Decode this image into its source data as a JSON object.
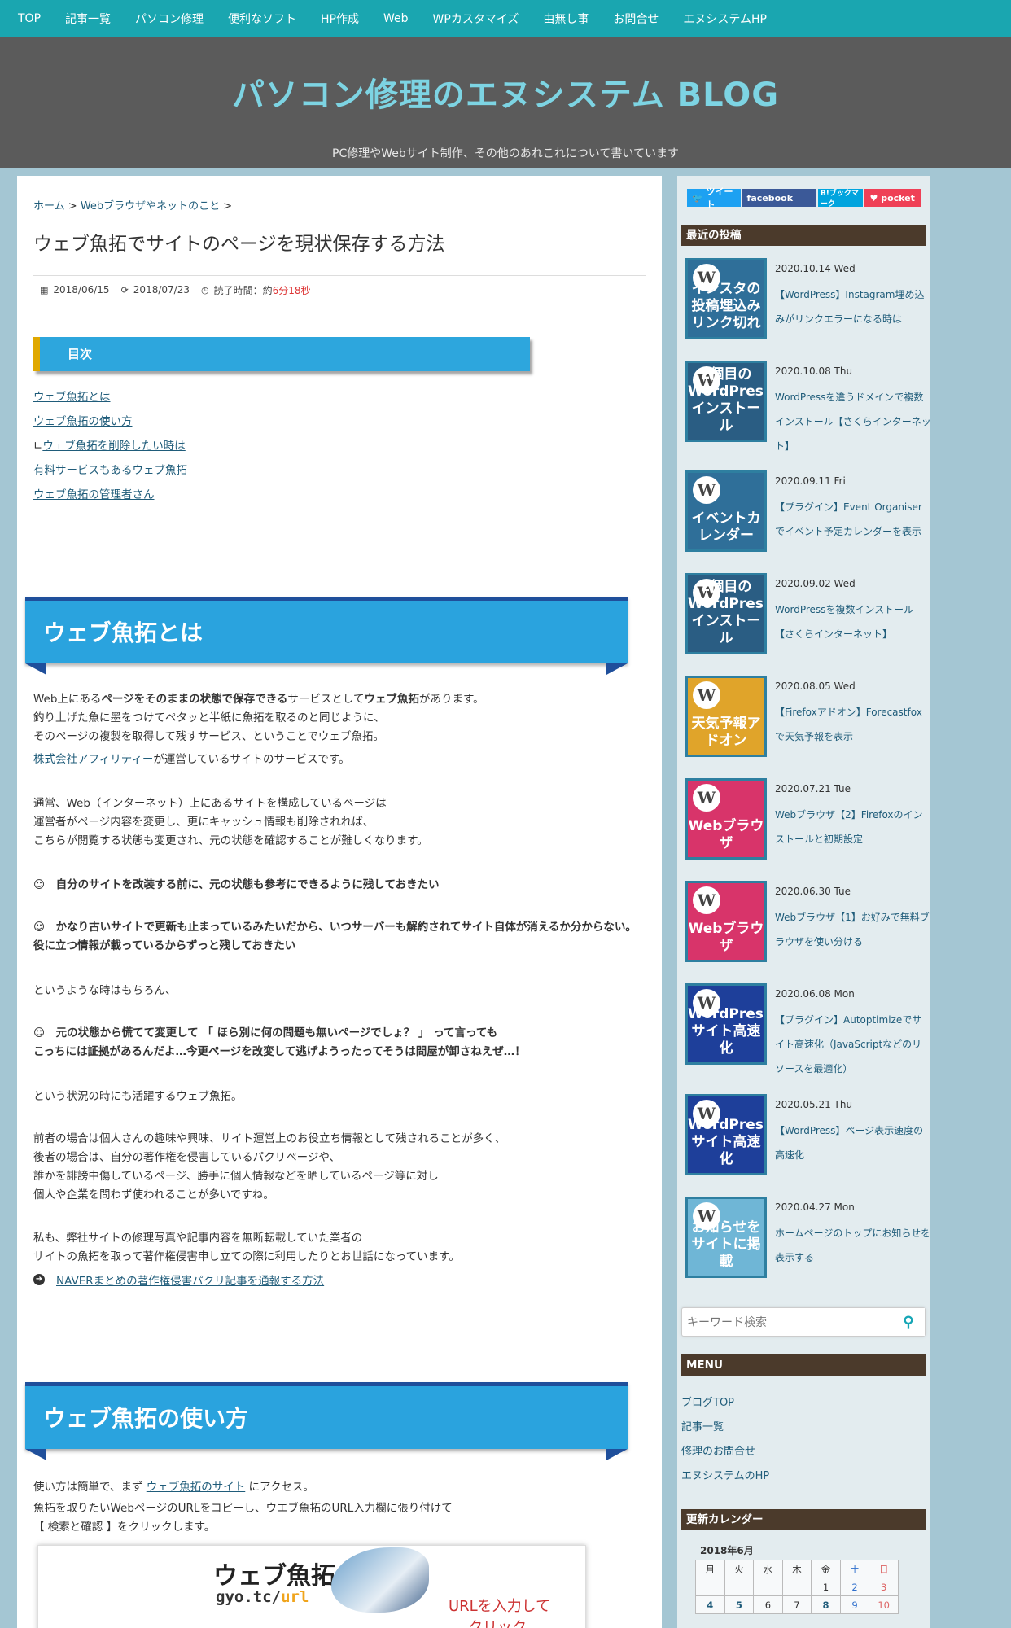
{
  "nav": [
    "TOP",
    "記事一覧",
    "パソコン修理",
    "便利なソフト",
    "HP作成",
    "Web",
    "WPカスタマイズ",
    "由無し事",
    "お問合せ",
    "エヌシステムHP"
  ],
  "header": {
    "title": "パソコン修理のエヌシステム BLOG",
    "description": "PC修理やWebサイト制作、その他のあれこれについて書いています"
  },
  "breadcrumb": {
    "home": "ホーム",
    "sep": ">",
    "category": "Webブラウザやネットのこと"
  },
  "post": {
    "title": "ウェブ魚拓でサイトのページを現状保存する方法",
    "published": "2018/06/15",
    "updated": "2018/07/23",
    "read_label": "読了時間：約",
    "read_time": "6分18秒"
  },
  "toc": {
    "title": "目次",
    "items": [
      "ウェブ魚拓とは",
      "ウェブ魚拓の使い方",
      "ウェブ魚拓を削除したい時は",
      "有料サービスもあるウェブ魚拓",
      "ウェブ魚拓の管理者さん"
    ],
    "sub_prefix": "∟"
  },
  "sections": {
    "s1": {
      "heading": "ウェブ魚拓とは"
    },
    "s2": {
      "heading": "ウェブ魚拓の使い方"
    }
  },
  "body": {
    "p1a": "Web上にある",
    "p1b": "ページをそのままの状態で保存できる",
    "p1c": "サービスとして",
    "p1d": "ウェブ魚拓",
    "p1e": "があります。",
    "p1f": "釣り上げた魚に墨をつけてペタッと半紙に魚拓を取るのと同じように、",
    "p1g": "そのページの複製を取得して残すサービス、ということでウェブ魚拓。",
    "p1h_link": "株式会社アフィリティー",
    "p1h": "が運営しているサイトのサービスです。",
    "p2a": "通常、Web（インターネット）上にあるサイトを構成しているページは",
    "p2b": "運営者がページ内容を変更し、更にキャッシュ情報も削除されれば、",
    "p2c": "こちらが閲覧する状態も変更され、元の状態を確認することが難しくなります。",
    "q1": "☺　自分のサイトを改装する前に、元の状態も参考にできるように残しておきたい",
    "q2": "☺　かなり古いサイトで更新も止まっているみたいだから、いつサーバーも解約されてサイト自体が消えるか分からない。役に立つ情報が載っているからずっと残しておきたい",
    "p3": "というような時はもちろん、",
    "q3a": "☺　元の状態から慌てて変更して 「 ほら別に何の問題も無いページでしょ？ 」 って言っても",
    "q3b": "こっちには証拠があるんだよ…今更ページを改変して逃げようったってそうは問屋が卸さねえぜ…！",
    "p4": "という状況の時にも活躍するウェブ魚拓。",
    "p5a": "前者の場合は個人さんの趣味や興味、サイト運営上のお役立ち情報として残されることが多く、",
    "p5b": "後者の場合は、自分の著作権を侵害しているパクリページや、",
    "p5c": "誰かを誹謗中傷しているページ、勝手に個人情報などを晒しているページ等に対し",
    "p5d": "個人や企業を問わず使われることが多いですね。",
    "p6a": "私も、弊社サイトの修理写真や記事内容を無断転載していた業者の",
    "p6b": "サイトの魚拓を取って著作権侵害申し立ての際に利用したりとお世話になっています。",
    "ext_link": "NAVERまとめの著作権侵害パクリ記事を通報する方法",
    "u1a": "使い方は簡単で、まず ",
    "u1_link": "ウェブ魚拓のサイト",
    "u1b": " にアクセス。",
    "u2": "魚拓を取りたいWebページのURLをコピーし、ウエブ魚拓のURL入力欄に張り付けて",
    "u3": "【 検索と確認 】をクリックします。"
  },
  "screenshot": {
    "logo": "ウェブ魚拓",
    "url_a": "gyo.tc/",
    "url_b": "url",
    "note": "URLを入力して",
    "note2": "クリック"
  },
  "sidebar": {
    "social": {
      "tweet": "ツイート",
      "facebook": "facebook",
      "hatena": "B!ブックマーク",
      "pocket": "pocket"
    },
    "recent_title": "最近の投稿",
    "recent": [
      {
        "date": "2020.10.14 Wed",
        "title": "【WordPress】Instagram埋め込みがリンクエラーになる時は",
        "thumb": "インスタの投稿埋込みリンク切れ",
        "color": "#2f6f99"
      },
      {
        "date": "2020.10.08 Thu",
        "title": "WordPressを違うドメインで複数インストール【さくらインターネット】",
        "thumb": "2個目のWordPressインストール",
        "color": "#2a5d83"
      },
      {
        "date": "2020.09.11 Fri",
        "title": "【プラグイン】Event Organiserでイベント予定カレンダーを表示",
        "thumb": "イベントカレンダー",
        "color": "#2f6f99"
      },
      {
        "date": "2020.09.02 Wed",
        "title": "WordPressを複数インストール【さくらインターネット】",
        "thumb": "2個目のWordPressインストール",
        "color": "#2a5d83"
      },
      {
        "date": "2020.08.05 Wed",
        "title": "【Firefoxアドオン】Forecastfoxで天気予報を表示",
        "thumb": "天気予報アドオン",
        "color": "#e0a42a"
      },
      {
        "date": "2020.07.21 Tue",
        "title": "Webブラウザ【2】Firefoxのインストールと初期設定",
        "thumb": "Webブラウザ",
        "color": "#d8346a"
      },
      {
        "date": "2020.06.30 Tue",
        "title": "Webブラウザ【1】お好みで無料ブラウザを使い分ける",
        "thumb": "Webブラウザ",
        "color": "#d8346a"
      },
      {
        "date": "2020.06.08 Mon",
        "title": "【プラグイン】Autoptimizeでサイト高速化（JavaScriptなどのリソースを最適化）",
        "thumb": "WordPressサイト高速化",
        "color": "#1e3f9a"
      },
      {
        "date": "2020.05.21 Thu",
        "title": "【WordPress】ページ表示速度の高速化",
        "thumb": "WordPressサイト高速化",
        "color": "#1e3f9a"
      },
      {
        "date": "2020.04.27 Mon",
        "title": "ホームページのトップにお知らせを表示する",
        "thumb": "お知らせをサイトに掲載",
        "color": "#6fb6d6"
      }
    ],
    "search_placeholder": "キーワード検索",
    "menu_title": "MENU",
    "menu": [
      "ブログTOP",
      "記事一覧",
      "修理のお問合せ",
      "エヌシステムのHP"
    ],
    "calendar_title": "更新カレンダー",
    "calendar": {
      "caption": "2018年6月",
      "days": [
        "月",
        "火",
        "水",
        "木",
        "金",
        "土",
        "日"
      ],
      "row1": [
        "",
        "",
        "",
        "",
        "1",
        "2",
        "3"
      ],
      "row2": [
        "4",
        "5",
        "6",
        "7",
        "8",
        "9",
        "10"
      ]
    }
  }
}
